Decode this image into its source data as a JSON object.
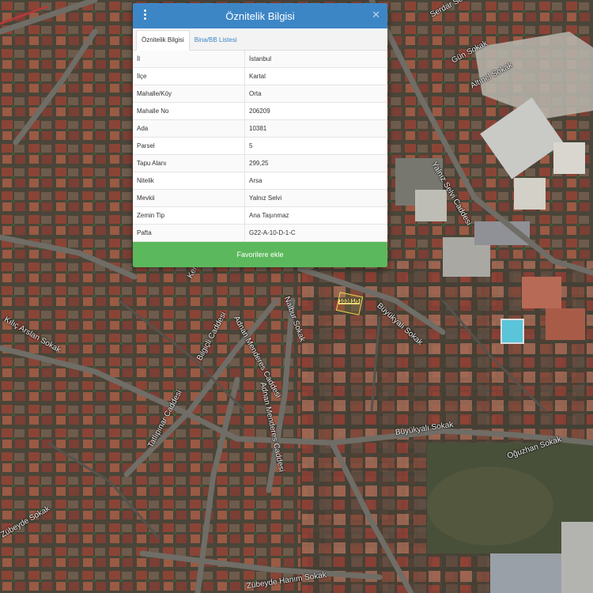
{
  "panel": {
    "title": "Öznitelik Bilgisi",
    "tabs": [
      {
        "label": "Öznitelik Bilgisi",
        "active": true
      },
      {
        "label": "Bina/BB Listesi",
        "active": false
      }
    ],
    "rows": [
      {
        "key": "İl",
        "value": "İstanbul"
      },
      {
        "key": "İlçe",
        "value": "Kartal"
      },
      {
        "key": "Mahalle/Köy",
        "value": "Orta"
      },
      {
        "key": "Mahalle No",
        "value": "206209"
      },
      {
        "key": "Ada",
        "value": "10381"
      },
      {
        "key": "Parsel",
        "value": "5"
      },
      {
        "key": "Tapu Alanı",
        "value": "299,25"
      },
      {
        "key": "Nitelik",
        "value": "Arsa"
      },
      {
        "key": "Mevkii",
        "value": "Yalnız Selvi"
      },
      {
        "key": "Zemin Tip",
        "value": "Ana Taşınmaz"
      },
      {
        "key": "Pafta",
        "value": "G22-A-10-D-1-C"
      }
    ],
    "favorite_button": "Favorilere ekle",
    "close_icon": "close-icon",
    "menu_icon": "vertical-dots-icon"
  },
  "map": {
    "parcel_label": "10381/5",
    "street_labels": [
      "Serdar Sokak",
      "Gün Sokak",
      "Altınel Sokak",
      "Yalnız Selvi Caddesi",
      "Büyükyalı Sokak",
      "Büyükyalı Sokak",
      "Oğuzhan Sokak",
      "Zübeyde Hanım Sokak",
      "Zübeyde Sokak",
      "Kılıç Arslan Sokak",
      "Tatlıpınar Caddesi",
      "Bilgiçli Caddesi",
      "Adnan Menderes Caddesi",
      "Adnan Menderes Caddesi",
      "Nalbur Sokak",
      "Kemalpaşa Caddesi"
    ],
    "colors": {
      "header": "#3d86c6",
      "button": "#5cb85c",
      "parcel_outline": "#f2d24a"
    }
  }
}
